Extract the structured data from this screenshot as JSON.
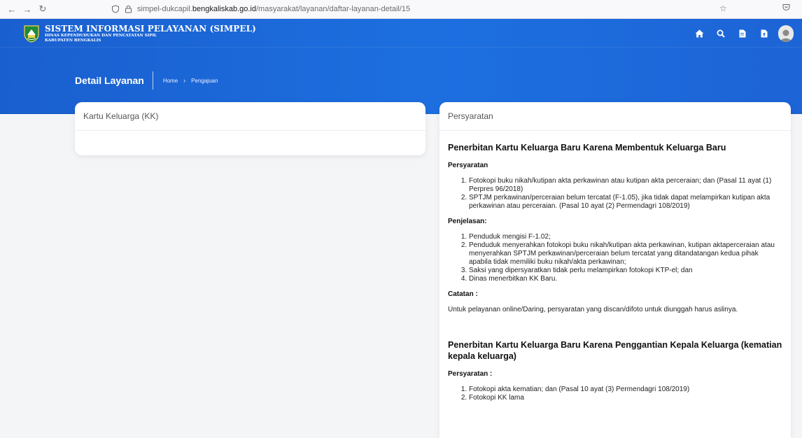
{
  "browser": {
    "url_prefix": "simpel-dukcapil.",
    "url_domain": "bengkaliskab.go.id",
    "url_path": "/masyarakat/layanan/daftar-layanan-detail/15"
  },
  "header": {
    "brand_title": "SISTEM INFORMASI PELAYANAN (SIMPEL)",
    "brand_sub1": "DINAS KEPENDUDUKAN DAN PENCATATAN SIPIL",
    "brand_sub2": "KABUPATEN BENGKALIS",
    "page_title": "Detail Layanan",
    "breadcrumb": {
      "home": "Home",
      "current": "Pengajuan"
    }
  },
  "colors": {
    "header_blue": "#1d6fe0",
    "card_bg": "#ffffff",
    "page_bg": "#f4f5f7"
  },
  "left_card": {
    "title": "Kartu Keluarga (KK)"
  },
  "right_card": {
    "title": "Persyaratan",
    "section1": {
      "heading": "Penerbitan Kartu Keluarga Baru Karena Membentuk Keluarga Baru",
      "req_label": "Persyaratan",
      "requirements": [
        "Fotokopi buku nikah/kutipan akta perkawinan atau kutipan akta perceraian; dan (Pasal 11 ayat (1) Perpres 96/2018)",
        "SPTJM perkawinan/perceraian belum tercatat (F-1.05), jika tidak dapat melampirkan kutipan akta perkawinan atau perceraian. (Pasal 10 ayat (2) Permendagri 108/2019)"
      ],
      "exp_label": "Penjelasan:",
      "explanations": [
        "Penduduk mengisi F-1.02;",
        "Penduduk menyerahkan fotokopi buku nikah/kutipan akta perkawinan, kutipan aktaperceraian atau menyerahkan SPTJM perkawinan/perceraian belum tercatat yang ditandatangan kedua pihak apabila tidak memiliki buku nikah/akta perkawinan;",
        "Saksi yang dipersyaratkan tidak perlu melampirkan fotokopi KTP-el; dan",
        "Dinas menerbitkan KK Baru."
      ],
      "note_label": "Catatan :",
      "note_text": "Untuk pelayanan online/Daring, persyaratan yang discan/difoto untuk diunggah harus aslinya."
    },
    "section2": {
      "heading": "Penerbitan Kartu Keluarga Baru Karena Penggantian Kepala Keluarga (kematian kepala keluarga)",
      "req_label": "Persyaratan :",
      "requirements": [
        "Fotokopi akta kematian; dan (Pasal 10 ayat (3) Permendagri 108/2019)",
        "Fotokopi KK lama"
      ]
    }
  }
}
